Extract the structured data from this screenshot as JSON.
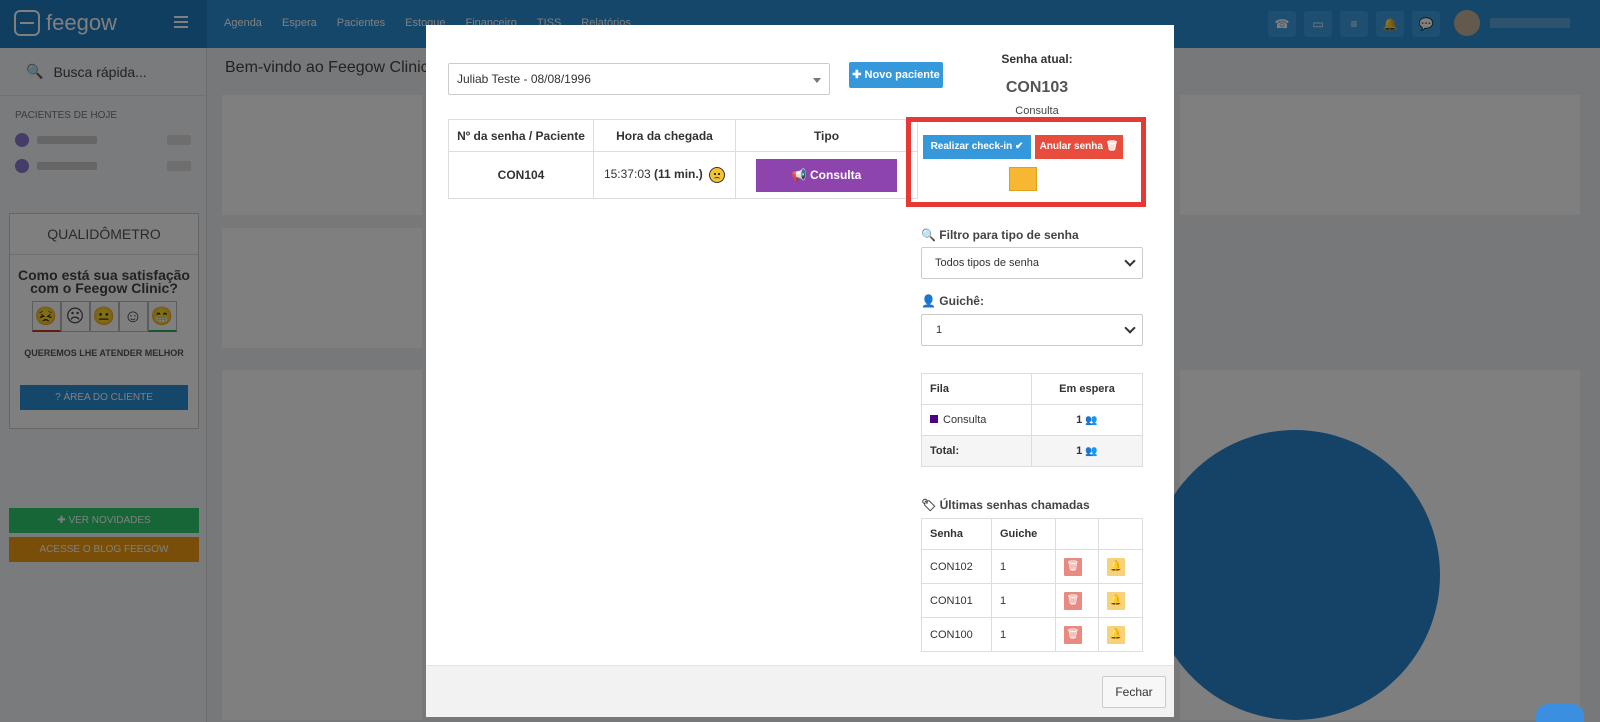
{
  "app": {
    "logo_text": "feegow",
    "nav": [
      "Agenda",
      "Espera",
      "Pacientes",
      "Estoque",
      "Financeiro",
      "TISS",
      "Relatórios"
    ]
  },
  "sidebar": {
    "search_label": "Busca rápida...",
    "today_title": "PACIENTES DE HOJE",
    "qualidometro": {
      "title": "QUALIDÔMETRO",
      "question": "Como está sua satisfação com o Feegow Clinic?",
      "faces": [
        "😣",
        "☹",
        "😐",
        "☺",
        "😁"
      ],
      "subtitle": "QUEREMOS LHE ATENDER MELHOR",
      "client_area_button": "ÁREA DO CLIENTE"
    },
    "news_button": "VER NOVIDADES",
    "blog_button": "ACESSE O BLOG FEEGOW"
  },
  "main": {
    "welcome": "Bem-vindo ao Feegow Clinic"
  },
  "modal": {
    "patient_select_value": "Juliab Teste - 08/08/1996",
    "new_patient_label": "Novo paciente",
    "queue_table": {
      "headers": [
        "Nº da senha / Paciente",
        "Hora da chegada",
        "Tipo"
      ],
      "rows": [
        {
          "senha": "CON104",
          "time": "15:37:03",
          "elapsed": "(11 min.)",
          "type": "Consulta"
        }
      ]
    },
    "current": {
      "label": "Senha atual:",
      "code": "CON103",
      "type": "Consulta",
      "checkin_label": "Realizar check-in ✔",
      "cancel_label": "Anular senha 🗑"
    },
    "filter": {
      "label": "Filtro para tipo de senha",
      "value": "Todos tipos de senha"
    },
    "guiche": {
      "label": "Guichê:",
      "value": "1"
    },
    "fila_table": {
      "headers": [
        "Fila",
        "Em espera"
      ],
      "rows": [
        {
          "name": "Consulta",
          "count": "1",
          "color": "#4b0082"
        }
      ],
      "total_label": "Total:",
      "total_count": "1"
    },
    "last_called": {
      "label": "Últimas senhas chamadas",
      "headers": [
        "Senha",
        "Guiche"
      ],
      "rows": [
        {
          "senha": "CON102",
          "guiche": "1"
        },
        {
          "senha": "CON101",
          "guiche": "1"
        },
        {
          "senha": "CON100",
          "guiche": "1"
        }
      ]
    },
    "close_label": "Fechar"
  }
}
